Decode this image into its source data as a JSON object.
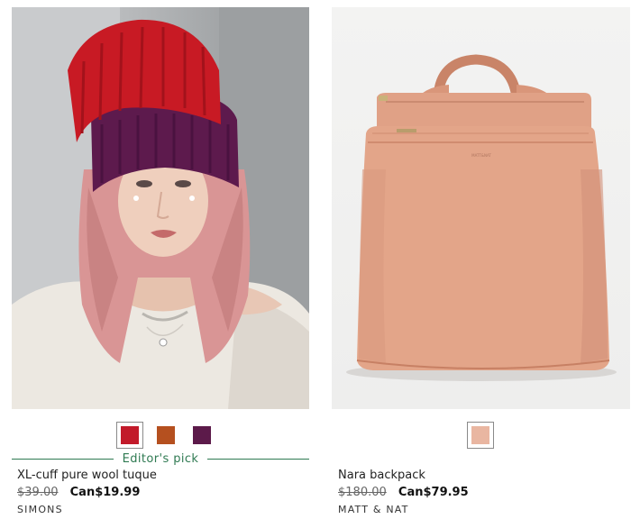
{
  "products": [
    {
      "name": "XL-cuff pure wool tuque",
      "original_price": "$39.00",
      "sale_price": "Can$19.99",
      "brand": "SIMONS",
      "badge": "Editor's pick",
      "image_alt": "model wearing red and purple stacked beanies",
      "swatches": [
        {
          "color": "#c21a2a",
          "selected": true
        },
        {
          "color": "#b5501f",
          "selected": false
        },
        {
          "color": "#5c1a4a",
          "selected": false
        }
      ]
    },
    {
      "name": "Nara backpack",
      "original_price": "$180.00",
      "sale_price": "Can$79.95",
      "brand": "MATT & NAT",
      "image_alt": "blush pink vegan leather backpack",
      "swatches": [
        {
          "color": "#e9b6a1",
          "selected": true
        }
      ]
    }
  ],
  "colors": {
    "accent_green": "#2f7a52"
  }
}
